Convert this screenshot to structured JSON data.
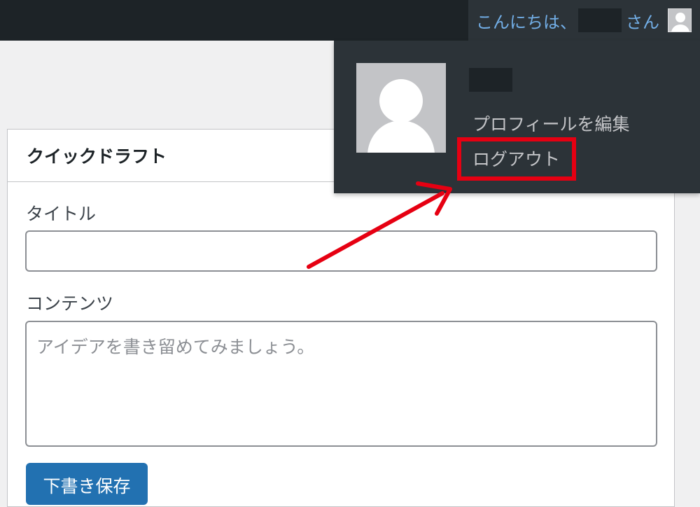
{
  "adminbar": {
    "greeting_prefix": "こんにちは、",
    "greeting_suffix": "さん",
    "colors": {
      "bar": "#1d2327",
      "account": "#2c3338",
      "link": "#72aee6"
    }
  },
  "user_menu": {
    "edit_profile_label": "プロフィールを編集",
    "logout_label": "ログアウト",
    "icons": {
      "avatar": "person-silhouette"
    }
  },
  "annotation": {
    "highlight_color": "#e60012",
    "arrow_color": "#e60012"
  },
  "quick_draft": {
    "title": "クイックドラフト",
    "title_label": "タイトル",
    "title_value": "",
    "content_label": "コンテンツ",
    "content_placeholder": "アイデアを書き留めてみましょう。",
    "save_button_label": "下書き保存",
    "colors": {
      "button": "#2271b1"
    }
  }
}
